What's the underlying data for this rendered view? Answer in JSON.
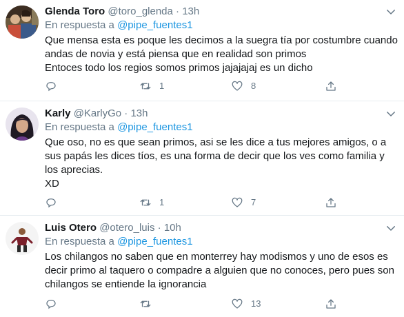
{
  "reply_prefix": "En respuesta a",
  "tweets": [
    {
      "name": "Glenda Toro",
      "handle": "@toro_glenda",
      "dot": "·",
      "time": "13h",
      "mention": "@pipe_fuentes1",
      "lines": [
        "Que mensa esta es poque les decimos a la suegra tía por costumbre cuando andas de novia y está piensa que en realidad son primos",
        "Entoces todo los regios somos primos jajajajaj es un dicho"
      ],
      "retweets": "1",
      "likes": "8"
    },
    {
      "name": "Karly",
      "handle": "@KarlyGo",
      "dot": "·",
      "time": "13h",
      "mention": "@pipe_fuentes1",
      "lines": [
        "Que oso, no es que sean primos, asi se les dice a tus mejores amigos, o a sus papás les dices tíos, es una forma de decir que los ves como familia y los aprecias.",
        "XD"
      ],
      "retweets": "1",
      "likes": "7"
    },
    {
      "name": "Luis Otero",
      "handle": "@otero_luis",
      "dot": "·",
      "time": "10h",
      "mention": "@pipe_fuentes1",
      "lines": [
        "Los chilangos no saben que en monterrey hay modismos y uno de esos es decir primo al taquero o compadre a alguien que no conoces, pero pues son chilangos se entiende la ignorancia"
      ],
      "retweets": "",
      "likes": "13"
    }
  ],
  "icons": [
    "reply-icon",
    "retweet-icon",
    "like-icon",
    "share-icon",
    "chevron-down-icon"
  ],
  "colors": {
    "link": "#1b95e0",
    "muted": "#657786",
    "text": "#14171a",
    "divider": "#e6ecf0"
  }
}
